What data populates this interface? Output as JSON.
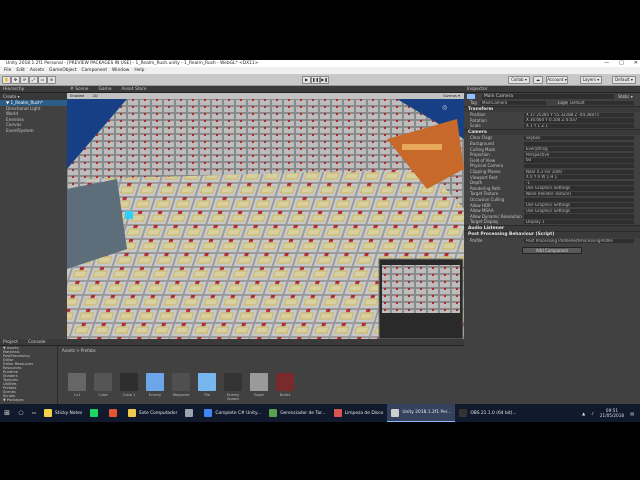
{
  "window": {
    "title": "Unity 2018.1.2f1 Personal - [PREVIEW PACKAGES IN USE] - 1_Realm_Rush.unity - 1_Realm_Rush - WebGL* <DX11>",
    "min": "—",
    "max": "□",
    "close": "✕"
  },
  "menu": [
    "File",
    "Edit",
    "Assets",
    "GameObject",
    "Component",
    "Window",
    "Help"
  ],
  "toolbar": {
    "collab": "Collab ▾",
    "account": "Account ▾",
    "layers": "Layers ▾",
    "layout": "Default ▾"
  },
  "hierarchy": {
    "tab": "Hierarchy",
    "create": "Create ▾",
    "items": [
      "▼ 1_Realm_Rush*",
      "  Directional Light",
      "  World",
      "  Enemies",
      "  Canvas",
      "  EventSystem"
    ]
  },
  "scene_tabs": [
    "# Scene",
    "Game",
    "Asset Store"
  ],
  "scene_toolbar": [
    "Shaded",
    "2D",
    "Gizmos ▾"
  ],
  "project": {
    "tab": "Project",
    "console_tab": "Console",
    "create": "Create ▾",
    "tree": [
      "▼ Assets",
      "  Materials",
      "  PostProcessing",
      "  Editor",
      "  Editor Resources",
      "  Resources",
      "  Runtime",
      "  Shaders",
      "  Textures",
      "  Utilities",
      "  Prefabs",
      "  Scenes",
      "  Scripts",
      "▼ Packages"
    ],
    "breadcrumb": "Assets > Prefabs",
    "assets": [
      {
        "label": "1x1",
        "color": "#666"
      },
      {
        "label": "Cube",
        "color": "#555"
      },
      {
        "label": "Cube 1",
        "color": "#2e2e2e"
      },
      {
        "label": "Enemy",
        "color": "#6aa6e8"
      },
      {
        "label": "Waypoint",
        "color": "#4f4f4f"
      },
      {
        "label": "Tile",
        "color": "#77b7f0"
      },
      {
        "label": "Enemy Spawn",
        "color": "#333"
      },
      {
        "label": "Tower",
        "color": "#9a9a9a"
      },
      {
        "label": "Bullet",
        "color": "#7a2a2a"
      }
    ]
  },
  "inspector": {
    "tab": "Inspector",
    "object_name": "Main Camera",
    "tag_label": "Tag",
    "tag": "MainCamera",
    "layer_label": "Layer",
    "layer": "Default",
    "static": "Static ▾",
    "transform": {
      "title": "Transform",
      "rows": [
        {
          "k": "Position",
          "v": "X 37.25285    Y 55.32288    Z -44.36875"
        },
        {
          "k": "Rotation",
          "v": "X 30.664    Y 0.104    Z 0.037"
        },
        {
          "k": "Scale",
          "v": "X 1    Y 1    Z 1"
        }
      ]
    },
    "camera": {
      "title": "Camera",
      "rows": [
        {
          "k": "Clear Flags",
          "v": "Skybox"
        },
        {
          "k": "Background",
          "v": ""
        },
        {
          "k": "Culling Mask",
          "v": "Everything"
        },
        {
          "k": "Projection",
          "v": "Perspective"
        },
        {
          "k": "Field of View",
          "v": "60"
        },
        {
          "k": "Physical Camera",
          "v": ""
        },
        {
          "k": "Clipping Planes",
          "v": "Near 0.3    Far 1000"
        },
        {
          "k": "Viewport Rect",
          "v": "X 0    Y 0    W 1    H 1"
        },
        {
          "k": "Depth",
          "v": "-1"
        },
        {
          "k": "Rendering Path",
          "v": "Use Graphics Settings"
        },
        {
          "k": "Target Texture",
          "v": "None (Render Texture)"
        },
        {
          "k": "Occlusion Culling",
          "v": ""
        },
        {
          "k": "Allow HDR",
          "v": "Use Graphics Settings"
        },
        {
          "k": "Allow MSAA",
          "v": "Use Graphics Settings"
        },
        {
          "k": "Allow Dynamic Resolution",
          "v": ""
        },
        {
          "k": "Target Display",
          "v": "Display 1"
        }
      ]
    },
    "audio_listener": "Audio Listener",
    "post_processing": "Post Processing Behaviour (Script)",
    "script_label": "Profile",
    "script_value": "Post Processing ProfilePostProcessingProfile",
    "add_component": "Add Component"
  },
  "taskbar": {
    "search_placeholder": "Sticky Notes",
    "tasks": [
      {
        "label": "Sticky Notes",
        "color": "#f3d24a"
      },
      {
        "label": "",
        "color": "#1ed760"
      },
      {
        "label": "",
        "color": "#e4572e"
      },
      {
        "label": "Este Computador",
        "color": "#f2c94c"
      },
      {
        "label": "",
        "color": "#9aa5b1"
      },
      {
        "label": "Complete C# Unity...",
        "color": "#4285f4"
      },
      {
        "label": "Gerenciador de Tar...",
        "color": "#59a14f"
      },
      {
        "label": "Limpeza de Disco",
        "color": "#d9534f"
      },
      {
        "label": "Unity 2018.1.2f1 Per...",
        "color": "#cfcfcf"
      },
      {
        "label": "OBS 21.1.0 (64 bit)...",
        "color": "#333333"
      }
    ],
    "time": "09:51",
    "date": "21/05/2018"
  }
}
